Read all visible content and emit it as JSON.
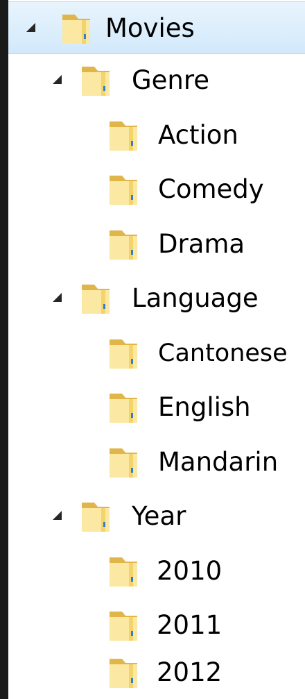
{
  "tree": {
    "root": {
      "label": "Movies",
      "icon": "folder-icon",
      "selected": true,
      "expanded": true
    },
    "groups": [
      {
        "label": "Genre",
        "icon": "folder-icon",
        "expanded": true,
        "children": [
          {
            "label": "Action",
            "icon": "folder-icon"
          },
          {
            "label": "Comedy",
            "icon": "folder-icon"
          },
          {
            "label": "Drama",
            "icon": "folder-icon"
          }
        ]
      },
      {
        "label": "Language",
        "icon": "folder-icon",
        "expanded": true,
        "children": [
          {
            "label": "Cantonese",
            "icon": "folder-icon"
          },
          {
            "label": "English",
            "icon": "folder-icon"
          },
          {
            "label": "Mandarin",
            "icon": "folder-icon"
          }
        ]
      },
      {
        "label": "Year",
        "icon": "folder-icon",
        "expanded": true,
        "children": [
          {
            "label": "2010",
            "icon": "folder-icon"
          },
          {
            "label": "2011",
            "icon": "folder-icon"
          },
          {
            "label": "2012",
            "icon": "folder-icon"
          }
        ]
      }
    ]
  },
  "colors": {
    "selection": "#d2e9fb",
    "folder_light": "#fbe8a2",
    "folder_dark": "#e0b64a",
    "text": "#000000"
  }
}
